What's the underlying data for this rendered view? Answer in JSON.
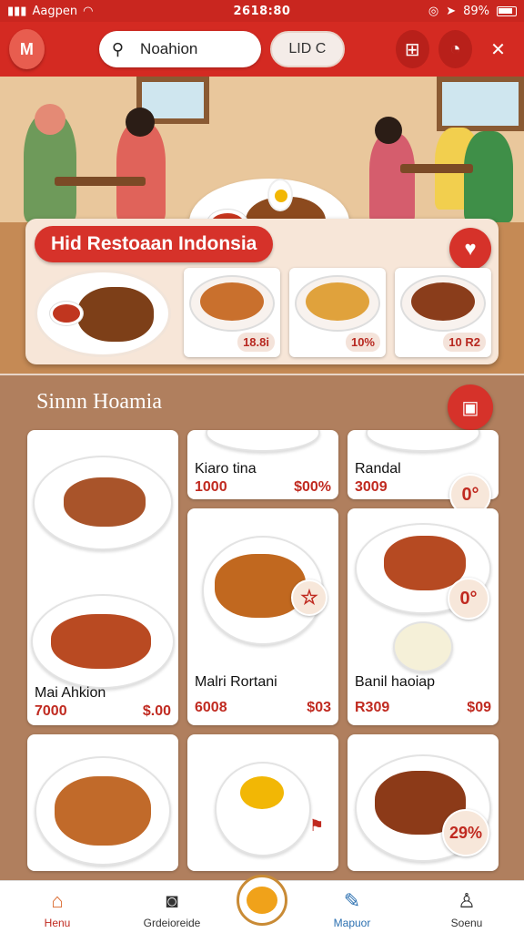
{
  "status": {
    "carrier": "Aagpen",
    "time": "2618:80",
    "battery": "89%"
  },
  "appbar": {
    "logo": "M",
    "search_placeholder": "Noahion",
    "pill_label": "LID C"
  },
  "featured": {
    "title": "Hid Restoaan Indonsia",
    "thumbs": [
      {
        "price": "18.8i"
      },
      {
        "price": "10%"
      },
      {
        "price": "10 R2"
      }
    ]
  },
  "section": {
    "title": "Sinnn Hoamia"
  },
  "cards": {
    "c1": {
      "name": "Mai Ahkion",
      "price_a": "7000",
      "price_b": "$.00"
    },
    "c2": {
      "name": "Kiaro tina",
      "price_a": "1000",
      "price_b": "$00%"
    },
    "c3": {
      "name": "Randal",
      "price_a": "3009",
      "badge": "0°"
    },
    "c4": {
      "name": "Malri Rortani",
      "price_a": "6008",
      "price_b": "$03"
    },
    "c5": {
      "name": "Banil haoiap",
      "price_a": "R309",
      "price_b": "$09",
      "badge": "0°"
    },
    "c8": {
      "badge": "29%"
    }
  },
  "nav": {
    "home": "Henu",
    "delivery": "Grdeioreide",
    "map": "Mapuor",
    "profile": "Soenu"
  },
  "colors": {
    "brand_red": "#d42a22",
    "section_bg": "#b07f5e"
  }
}
